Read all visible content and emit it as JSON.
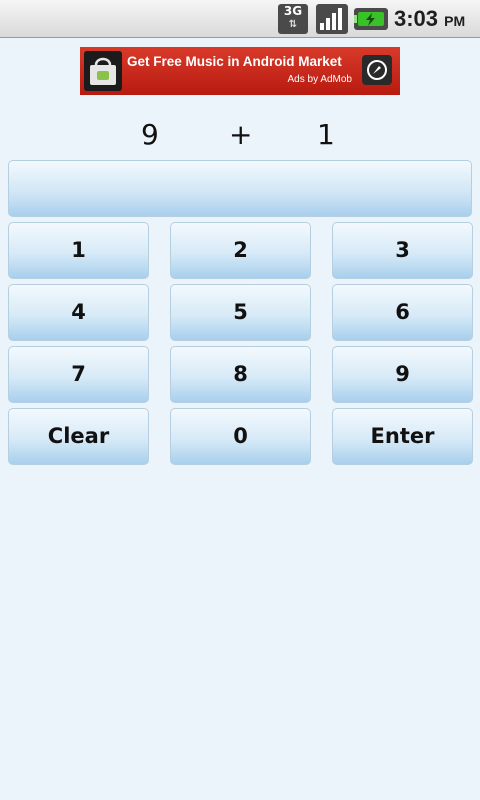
{
  "status_bar": {
    "network": "3G",
    "time": "3:03",
    "ampm": "PM",
    "icons": [
      "3g-data-icon",
      "signal-strength-icon",
      "battery-charging-icon"
    ]
  },
  "ad": {
    "title": "Get Free Music in Android Market",
    "subtitle": "Ads by AdMob",
    "icons": [
      "android-market-bag-icon",
      "compass-icon"
    ],
    "background_color": "#c8281b"
  },
  "equation": {
    "operand_a": "9",
    "operator": "+",
    "operand_b": "1"
  },
  "answer": {
    "value": ""
  },
  "keypad": {
    "keys": [
      "1",
      "2",
      "3",
      "4",
      "5",
      "6",
      "7",
      "8",
      "9",
      "Clear",
      "0",
      "Enter"
    ]
  },
  "colors": {
    "background": "#eaf4fa",
    "button_top": "#f3f9fd",
    "button_bottom": "#a8cfed"
  }
}
